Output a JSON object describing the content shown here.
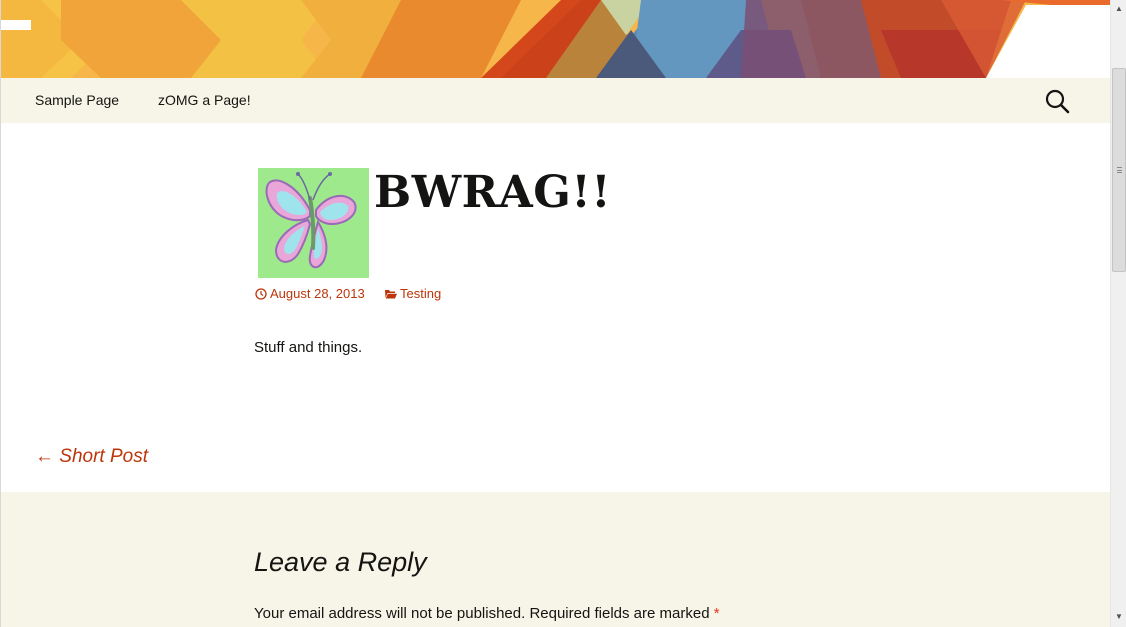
{
  "nav": {
    "items": [
      {
        "label": "Sample Page"
      },
      {
        "label": "zOMG a Page!"
      }
    ]
  },
  "post": {
    "title": "BWRAG!!",
    "date": "August 28, 2013",
    "category": "Testing",
    "content": "Stuff and things."
  },
  "navigation": {
    "prev_label": "← Short Post"
  },
  "comments": {
    "title": "Leave a Reply",
    "notes": "Your email address will not be published. Required fields are marked",
    "required_mark": "*"
  },
  "icons": {
    "search": "search-icon",
    "date": "clock-icon",
    "category": "folder-icon"
  },
  "colors": {
    "accent": "#bc360a",
    "nav_bg": "#f7f5e7",
    "text": "#141412"
  }
}
